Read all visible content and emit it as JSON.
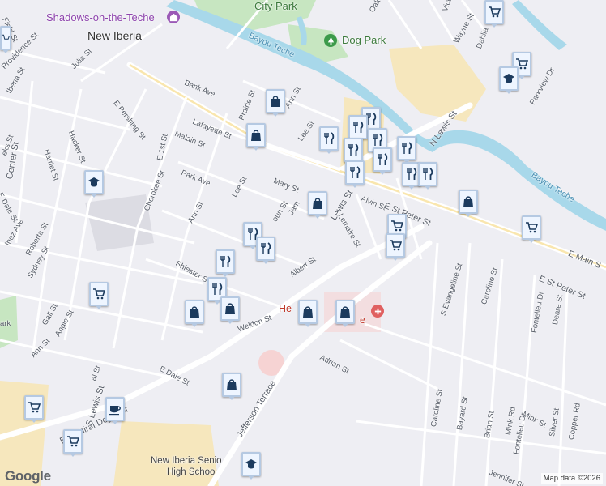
{
  "map": {
    "attribution": "Map data ©2026",
    "logo": "Google",
    "colors": {
      "land": "#eeeef3",
      "water": "#a8d8ea",
      "park": "#c7e6c1",
      "commercial": "#f6e7bd",
      "hospital": "#f6d3d3",
      "road": "#ffffff",
      "pin_icon": "#1c3b5e"
    }
  },
  "labels": {
    "new_iberia": "New Iberia",
    "shadows": "Shadows-on-the-Teche",
    "city_park": "City Park",
    "dog_park": "Dog Park",
    "bayou_teche_1": "Bayou Teche",
    "bayou_teche_2": "Bayou Teche",
    "new_iberia_senior_1": "New Iberia Senio",
    "new_iberia_senior_2": "High Schoo",
    "hospital_1": "He",
    "hospital_2": "e",
    "park_left": "ark",
    "streets": {
      "ruth_st": "Field St",
      "providence_st": "Providence St",
      "julia_st": "Julia St",
      "iberia_st": "Iberia St",
      "bank_ave": "Bank Ave",
      "e_pershing_st": "E Pershing St",
      "prairie_st": "Prairie St",
      "ann_st_top": "Ann St",
      "lafayette_st": "Lafayette St",
      "malain_st": "Malain St",
      "lee_st_top": "Lee St",
      "hacker_st": "Hacker St",
      "harriet_st": "Harriet St",
      "center_st": "Center St",
      "e_dale_st_left": "E Dale St",
      "e_1st_st": "E 1st St",
      "park_ave": "Park Ave",
      "cherokee_st": "Cherokee St",
      "ann_st_mid": "Ann St",
      "lee_st_mid": "Lee St",
      "mary_st": "Mary St",
      "james_st": "Jam",
      "calhoun_st": "oun St",
      "lewis_st": "Lewis St",
      "alvin_st": "Alvin St",
      "lemaire_st": "Lemaire St",
      "e_st_peter_st_1": "E St Peter St",
      "e_st_peter_st_2": "E St Peter St",
      "e_main_st": "E Main S",
      "n_lewis_st": "N Lewis St",
      "parkview_dr": "Parkview Dr",
      "oak_st": "Oak St",
      "wayne_st": "Wayne St",
      "victor_st": "Victo",
      "dahlia_st": "Dahlia",
      "inez_ave": "Inez Ave",
      "roberta_st": "Roberta St",
      "sydney_st": "Sydney St",
      "shiester_st": "Shiester St",
      "albert_st": "Albert St",
      "gall_st": "Gall St",
      "angle_st": "Angle St",
      "ann_st_low": "Ann St",
      "weldon_st": "Weldon St",
      "e_dale_st_low": "E Dale St",
      "jefferson_terrace": "Jefferson Terrace",
      "adrian_st": "Adrian St",
      "s_evangeline_st": "S Evangeline St",
      "caroline_st_1": "Caroline St",
      "caroline_st_2": "Caroline St",
      "bayard_st": "Bayard St",
      "brian_st": "Brian St",
      "mink_rd": "Mink Rd",
      "mink_st": "Mink St",
      "fontelieu_dr_1": "Fontelieu Dr",
      "fontelieu_dr_2": "Fontelieu Dr",
      "deare_st": "Deare St",
      "silver_st": "Silver St",
      "copper_rd": "Copper Rd",
      "jennifer_st": "Jennifer St",
      "e_admiral_doyle_dr": "E Admiral Doyle Dr",
      "s_lewis_st": "S Lewis St",
      "ks_st": "eks St",
      "il_st": "al St"
    }
  },
  "markers": [
    {
      "name": "grocery-pin",
      "icon": "cart"
    },
    {
      "name": "grocery-pin",
      "icon": "cart"
    },
    {
      "name": "school-pin",
      "icon": "school"
    },
    {
      "name": "school-pin",
      "icon": "school"
    },
    {
      "name": "shopping-pin",
      "icon": "bag"
    },
    {
      "name": "shopping-pin",
      "icon": "bag"
    },
    {
      "name": "restaurant-pin",
      "icon": "fork-knife"
    },
    {
      "name": "restaurant-pin",
      "icon": "fork-knife"
    },
    {
      "name": "restaurant-pin",
      "icon": "fork-knife"
    },
    {
      "name": "restaurant-pin",
      "icon": "fork-knife"
    },
    {
      "name": "restaurant-pin",
      "icon": "fork-knife"
    },
    {
      "name": "restaurant-pin",
      "icon": "fork-knife"
    },
    {
      "name": "restaurant-pin",
      "icon": "fork-knife"
    },
    {
      "name": "restaurant-pin",
      "icon": "fork-knife"
    },
    {
      "name": "restaurant-pin",
      "icon": "fork-knife"
    },
    {
      "name": "shopping-pin",
      "icon": "bag"
    },
    {
      "name": "shopping-pin",
      "icon": "bag"
    },
    {
      "name": "grocery-pin",
      "icon": "cart"
    },
    {
      "name": "grocery-pin",
      "icon": "cart"
    },
    {
      "name": "grocery-pin",
      "icon": "cart"
    },
    {
      "name": "restaurant-pin",
      "icon": "fork-knife"
    },
    {
      "name": "restaurant-pin",
      "icon": "fork-knife"
    },
    {
      "name": "restaurant-pin",
      "icon": "fork-knife"
    },
    {
      "name": "grocery-pin",
      "icon": "cart"
    },
    {
      "name": "restaurant-pin",
      "icon": "fork-knife"
    },
    {
      "name": "shopping-pin",
      "icon": "bag"
    },
    {
      "name": "shopping-pin",
      "icon": "bag"
    },
    {
      "name": "shopping-pin",
      "icon": "bag"
    },
    {
      "name": "shopping-pin",
      "icon": "bag"
    },
    {
      "name": "shopping-pin",
      "icon": "bag"
    },
    {
      "name": "grocery-pin",
      "icon": "cart"
    },
    {
      "name": "cafe-pin",
      "icon": "cup"
    },
    {
      "name": "grocery-pin",
      "icon": "cart"
    },
    {
      "name": "school-pin",
      "icon": "school"
    },
    {
      "name": "grocery-pin",
      "icon": "cart"
    }
  ]
}
